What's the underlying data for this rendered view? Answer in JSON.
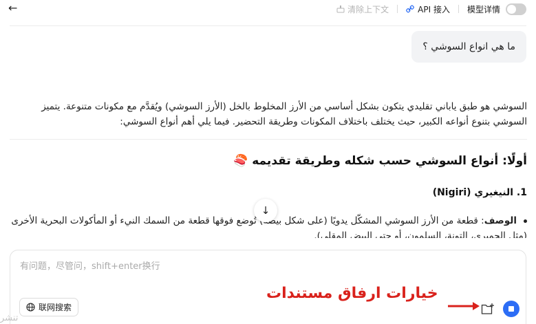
{
  "topbar": {
    "clear_context": "清除上下文",
    "api_access": "API 接入",
    "model_details": "模型详情",
    "model_details_enabled": false
  },
  "user_message": "ما هي انواع السوشي ؟",
  "answer": {
    "intro": "السوشي هو طبق ياباني تقليدي يتكون بشكل أساسي من الأرز المخلوط بالخل (الأرز السوشي) ويُقدَّم مع مكونات متنوعة. يتميز السوشي بتنوع أنواعه الكبير، حيث يختلف باختلاف المكونات وطريقة التحضير. فيما يلي أهم أنواع السوشي:",
    "heading": "أولًا: أنواع السوشي حسب شكله وطريقة تقديمه 🍣",
    "subheading": "1. النيغيري (Nigiri)",
    "bullet_label": "الوصف",
    "bullet_text": ": قطعة من الأرز السوشي المشكّل يدويًا (على شكل بيضة) تُوضع فوقها قطعة من السمك النيء أو المأكولات البحرية الأخرى (مثل الجمبري، التونة، السلمون، أو حتى البيض المقلي)."
  },
  "input": {
    "placeholder": "有问题，尽管问，shift+enter换行",
    "web_search": "联网搜索",
    "annotation": "خيارات ارفاق مستندات"
  },
  "bottom_fragment": "تنشر"
}
